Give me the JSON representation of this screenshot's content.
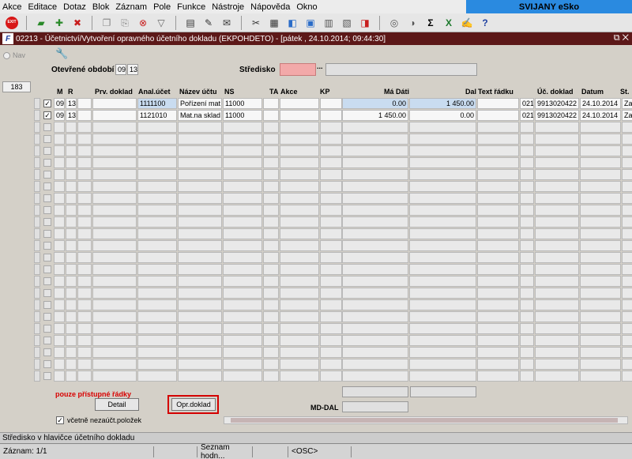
{
  "menu": [
    "Akce",
    "Editace",
    "Dotaz",
    "Blok",
    "Záznam",
    "Pole",
    "Funkce",
    "Nástroje",
    "Nápověda",
    "Okno"
  ],
  "brand": "SVIJANY eSko",
  "toolbar": {
    "exit_label": "EXIT",
    "icons": [
      "save-icon",
      "insert-record-icon",
      "delete-record-icon",
      "copy-icon",
      "paste-icon",
      "clear-icon",
      "filter-icon",
      "print-icon",
      "attach-icon",
      "mail-icon",
      "cut-icon",
      "calculator-icon",
      "query-icon",
      "lock-icon",
      "globe-icon",
      "sum-icon",
      "excel-icon",
      "help-icon"
    ]
  },
  "window": {
    "app_icon": "F",
    "title": "02213 - Účetnictví/Vytvoření opravného účetního dokladu (EKPOHDETO) - [pátek  , 24.10.2014; 09:44:30]",
    "controls": "⧉ ✕"
  },
  "left": {
    "nav_label": "Nav",
    "count": "183"
  },
  "header": {
    "period_label": "Otevřené období",
    "period_a": "09",
    "period_b": "13",
    "center_label": "Středisko",
    "center_value": "",
    "center_name": "",
    "lookup": "..."
  },
  "columns": [
    "M",
    "R",
    "Prv. doklad",
    "Anal.účet",
    "Název účtu",
    "NS",
    "TA",
    "Akce",
    "KP",
    "Má Dáti",
    "Dal",
    "Text řádku",
    "Úč. doklad",
    "Datum",
    "St."
  ],
  "rows": [
    {
      "check": "✓",
      "m": "09",
      "r": "13",
      "prv": "",
      "anal": "1111100",
      "nazev": "Pořízení mat",
      "ns": "11000",
      "ta": "",
      "akce": "",
      "kp": "",
      "md": "0.00",
      "dal": "1 450.00",
      "text": "",
      "kod": "021",
      "doklad": "9913020422",
      "datum": "24.10.2014",
      "st": "Za"
    },
    {
      "check": "✓",
      "m": "09",
      "r": "13",
      "prv": "",
      "anal": "1121010",
      "nazev": "Mat.na sklad",
      "ns": "11000",
      "ta": "",
      "akce": "",
      "kp": "",
      "md": "1 450.00",
      "dal": "0.00",
      "text": "",
      "kod": "021",
      "doklad": "9913020422",
      "datum": "24.10.2014",
      "st": "Za"
    }
  ],
  "empty_rows": 22,
  "bottom": {
    "red_note": "pouze přístupné řádky",
    "detail_button": "Detail",
    "correction_button": "Opr.doklad",
    "md_dal_label": "MD-DAL",
    "include_label": "včetně nezaúčt.položek",
    "include_checked": "✓"
  },
  "hint": "Středisko v hlavičce účetního dokladu",
  "status": {
    "record": "Záznam: 1/1",
    "seg2": "",
    "list": "Seznam hodn...",
    "seg4": "",
    "osc": "<OSC>"
  }
}
